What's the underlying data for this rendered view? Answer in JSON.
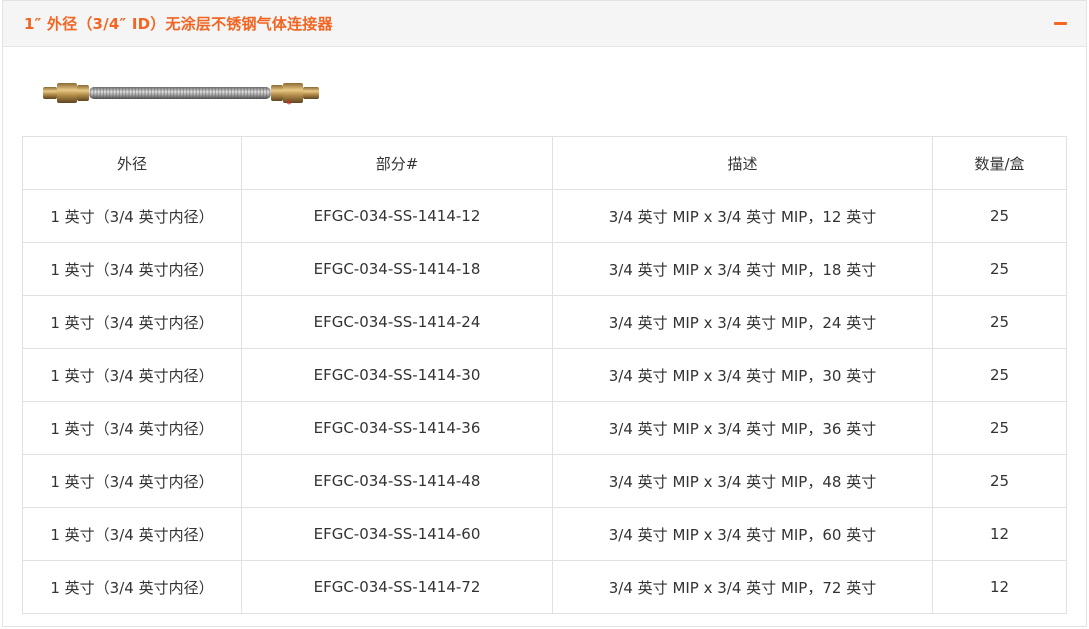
{
  "header": {
    "title": "1″ 外径（3/4″ ID）无涂层不锈钢气体连接器",
    "collapse_symbol": "−"
  },
  "product_image": {
    "icon": "stainless-flex-gas-connector-image"
  },
  "table": {
    "headers": [
      "外径",
      "部分#",
      "描述",
      "数量/盒"
    ],
    "rows": [
      [
        "1 英寸（3/4 英寸内径）",
        "EFGC-034-SS-1414-12",
        "3/4 英寸 MIP x 3/4 英寸 MIP，12 英寸",
        "25"
      ],
      [
        "1 英寸（3/4 英寸内径）",
        "EFGC-034-SS-1414-18",
        "3/4 英寸 MIP x 3/4 英寸 MIP，18 英寸",
        "25"
      ],
      [
        "1 英寸（3/4 英寸内径）",
        "EFGC-034-SS-1414-24",
        "3/4 英寸 MIP x 3/4 英寸 MIP，24 英寸",
        "25"
      ],
      [
        "1 英寸（3/4 英寸内径）",
        "EFGC-034-SS-1414-30",
        "3/4 英寸 MIP x 3/4 英寸 MIP，30 英寸",
        "25"
      ],
      [
        "1 英寸（3/4 英寸内径）",
        "EFGC-034-SS-1414-36",
        "3/4 英寸 MIP x 3/4 英寸 MIP，36 英寸",
        "25"
      ],
      [
        "1 英寸（3/4 英寸内径）",
        "EFGC-034-SS-1414-48",
        "3/4 英寸 MIP x 3/4 英寸 MIP，48 英寸",
        "25"
      ],
      [
        "1 英寸（3/4 英寸内径）",
        "EFGC-034-SS-1414-60",
        "3/4 英寸 MIP x 3/4 英寸 MIP，60 英寸",
        "12"
      ],
      [
        "1 英寸（3/4 英寸内径）",
        "EFGC-034-SS-1414-72",
        "3/4 英寸 MIP x 3/4 英寸 MIP，72 英寸",
        "12"
      ]
    ]
  },
  "colors": {
    "accent": "#f26522",
    "header_bg": "#f5f5f5",
    "border": "#e1e1e1"
  }
}
